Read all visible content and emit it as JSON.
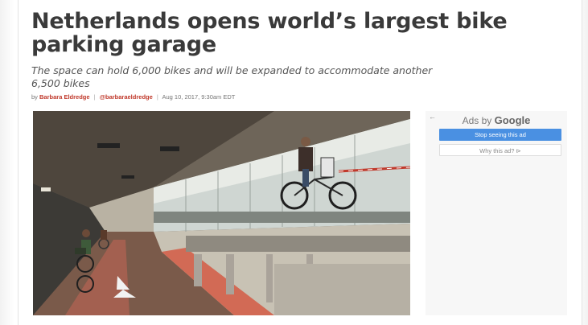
{
  "article": {
    "headline": "Netherlands opens world’s largest bike parking garage",
    "subhead": "The space can hold 6,000 bikes and will be expanded to accommodate another 6,500 bikes",
    "byline": {
      "prefix": "by",
      "author": "Barbara Eldredge",
      "separator": "|",
      "handle": "@barbaraeldredge",
      "date": "Aug 10, 2017, 9:30am EDT"
    },
    "image_alt": "Cyclists riding through the bike parking garage"
  },
  "ad": {
    "back_icon": "arrow-left-icon",
    "ads_by_label": "Ads by",
    "google_label": "Google",
    "stop_button_label": "Stop seeing this ad",
    "why_button_label": "Why this ad? ⊳"
  },
  "colors": {
    "headline": "#3a3a3a",
    "byline_accent": "#c0392b",
    "ad_button": "#4a90e2"
  }
}
